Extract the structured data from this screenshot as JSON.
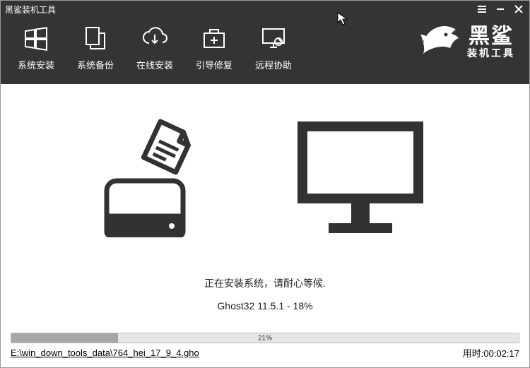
{
  "titlebar": {
    "title": "黑鲨装机工具"
  },
  "nav": {
    "items": [
      {
        "label": "系统安装"
      },
      {
        "label": "系统备份"
      },
      {
        "label": "在线安装"
      },
      {
        "label": "引导修复"
      },
      {
        "label": "远程协助"
      }
    ]
  },
  "logo": {
    "big": "黑鲨",
    "small": "装机工具"
  },
  "status": {
    "line1": "正在安装系统，请耐心等候.",
    "line2": "Ghost32 11.5.1 - 18%"
  },
  "progress": {
    "percent": 21,
    "label": "21%"
  },
  "footer": {
    "filepath": "E:\\win_down_tools_data\\764_hei_17_9_4.gho",
    "time_label": "用时:",
    "time_value": "00:02:17"
  }
}
